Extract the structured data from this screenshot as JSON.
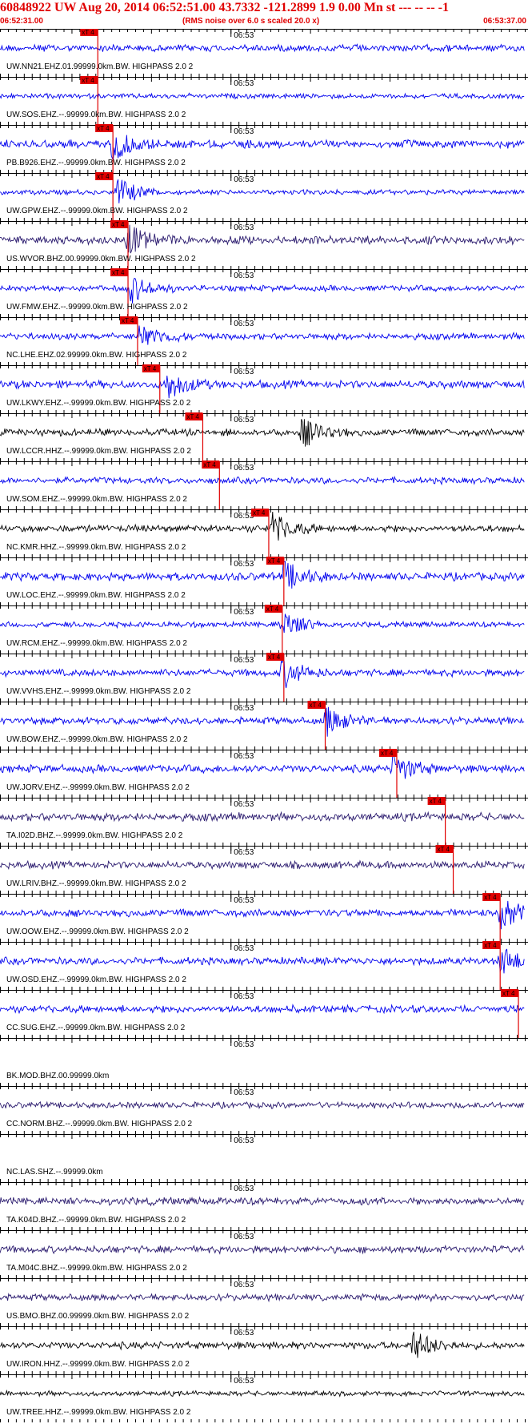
{
  "header": {
    "title": "60848922 UW Aug 20, 2014 06:52:51.00   43.7332 -121.2899  1.9 0.00 Mn st --- -- --   -1",
    "start_time": "06:52:31.00",
    "rms_note": "(RMS noise over 6.0 s scaled 20.0 x)",
    "end_time": "06:53:37.00"
  },
  "colors": {
    "title": "#e00000",
    "trace_blue": "#0000ee",
    "trace_black": "#000000",
    "trace_purple": "#2a1a6e",
    "pick_marker": "#e00000"
  },
  "chart_data": {
    "type": "line",
    "x_range": [
      "06:52:31.00",
      "06:53:37.00"
    ],
    "center_tick_label": "06:53",
    "pick_label": "xT 4",
    "traces": [
      {
        "label": "UW.NN21.EHZ.01.99999.0km.BW. HIGHPASS  2.0  2",
        "color": "blue",
        "pick_s": 12.3,
        "burst_s": null
      },
      {
        "label": "UW.SOS.EHZ.--.99999.0km.BW. HIGHPASS  2.0  2",
        "color": "blue",
        "pick_s": 12.3,
        "burst_s": null
      },
      {
        "label": "PB.B926.EHZ.--.99999.0km.BW. HIGHPASS  2.0  2",
        "color": "blue",
        "pick_s": 14.2,
        "burst_s": 14.2
      },
      {
        "label": "UW.GPW.EHZ.--.99999.0km.BW. HIGHPASS  2.0  2",
        "color": "blue",
        "pick_s": 14.2,
        "burst_s": 14.8
      },
      {
        "label": "US.WVOR.BHZ.00.99999.0km.BW. HIGHPASS  2.0  2",
        "color": "purple",
        "pick_s": 16.1,
        "burst_s": 16.1
      },
      {
        "label": "UW.FMW.EHZ.--.99999.0km.BW. HIGHPASS  2.0  2",
        "color": "blue",
        "pick_s": 16.1,
        "burst_s": 16.3
      },
      {
        "label": "NC.LHE.EHZ.02.99999.0km.BW. HIGHPASS  2.0  2",
        "color": "blue",
        "pick_s": 17.3,
        "burst_s": 17.6
      },
      {
        "label": "UW.LKWY.EHZ.--.99999.0km.BW. HIGHPASS  2.0  2",
        "color": "blue",
        "pick_s": 20.1,
        "burst_s": 21.0
      },
      {
        "label": "UW.LCCR.HHZ.--.99999.0km.BW. HIGHPASS  2.0  2",
        "color": "black",
        "pick_s": 25.5,
        "burst_s": 38.0
      },
      {
        "label": "UW.SOM.EHZ.--.99999.0km.BW. HIGHPASS  2.0  2",
        "color": "blue",
        "pick_s": 27.6,
        "burst_s": null
      },
      {
        "label": "NC.KMR.HHZ.--.99999.0km.BW. HIGHPASS  2.0  2",
        "color": "black",
        "pick_s": 33.8,
        "burst_s": 34.3
      },
      {
        "label": "UW.LOC.EHZ.--.99999.0km.BW. HIGHPASS  2.0  2",
        "color": "blue",
        "pick_s": 35.7,
        "burst_s": 35.7
      },
      {
        "label": "UW.RCM.EHZ.--.99999.0km.BW. HIGHPASS  2.0  2",
        "color": "blue",
        "pick_s": 35.5,
        "burst_s": 35.5
      },
      {
        "label": "UW.VVHS.EHZ.--.99999.0km.BW. HIGHPASS  2.0  2",
        "color": "blue",
        "pick_s": 35.7,
        "burst_s": 35.5
      },
      {
        "label": "UW.BOW.EHZ.--.99999.0km.BW. HIGHPASS  2.0  2",
        "color": "blue",
        "pick_s": 40.9,
        "burst_s": 41.0
      },
      {
        "label": "UW.JORV.EHZ.--.99999.0km.BW. HIGHPASS  2.0  2",
        "color": "blue",
        "pick_s": 49.9,
        "burst_s": 49.5
      },
      {
        "label": "TA.I02D.BHZ.--.99999.0km.BW. HIGHPASS  2.0  2",
        "color": "purple",
        "pick_s": 56.0,
        "burst_s": null
      },
      {
        "label": "UW.LRIV.BHZ.--.99999.0km.BW. HIGHPASS  2.0  2",
        "color": "purple",
        "pick_s": 57.0,
        "burst_s": null
      },
      {
        "label": "UW.OOW.EHZ.--.99999.0km.BW. HIGHPASS  2.0  2",
        "color": "blue",
        "pick_s": 62.9,
        "burst_s": 63.0
      },
      {
        "label": "UW.OSD.EHZ.--.99999.0km.BW. HIGHPASS  2.0  2",
        "color": "blue",
        "pick_s": 62.9,
        "burst_s": 63.0
      },
      {
        "label": "CC.SUG.EHZ.--.99999.0km.BW. HIGHPASS  2.0  2",
        "color": "blue",
        "pick_s": 65.2,
        "burst_s": null
      },
      {
        "label": "BK.MOD.BHZ.00.99999.0km",
        "color": "none",
        "pick_s": null,
        "burst_s": null
      },
      {
        "label": "CC.NORM.BHZ.--.99999.0km.BW. HIGHPASS  2.0  2",
        "color": "purple",
        "pick_s": null,
        "burst_s": null
      },
      {
        "label": "NC.LAS.SHZ.--.99999.0km",
        "color": "none",
        "pick_s": null,
        "burst_s": null
      },
      {
        "label": "TA.K04D.BHZ.--.99999.0km.BW. HIGHPASS  2.0  2",
        "color": "purple",
        "pick_s": null,
        "burst_s": null
      },
      {
        "label": "TA.M04C.BHZ.--.99999.0km.BW. HIGHPASS  2.0  2",
        "color": "purple",
        "pick_s": null,
        "burst_s": null
      },
      {
        "label": "US.BMO.BHZ.00.99999.0km.BW. HIGHPASS  2.0  2",
        "color": "purple",
        "pick_s": null,
        "burst_s": null
      },
      {
        "label": "UW.IRON.HHZ.--.99999.0km.BW. HIGHPASS  2.0  2",
        "color": "black",
        "pick_s": null,
        "burst_s": 52.0
      },
      {
        "label": "UW.TREE.HHZ.--.99999.0km.BW. HIGHPASS  2.0  2",
        "color": "black",
        "pick_s": null,
        "burst_s": null
      }
    ]
  }
}
